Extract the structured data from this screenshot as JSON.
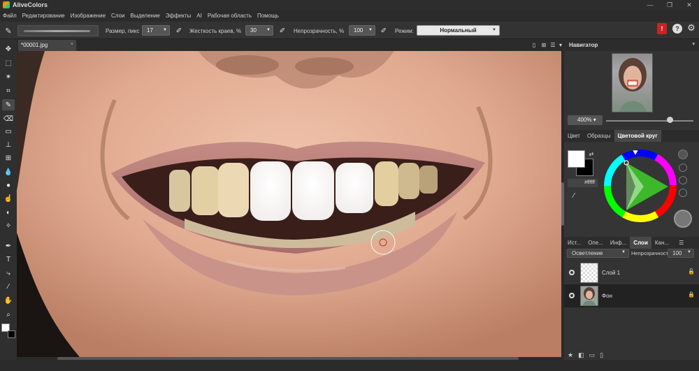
{
  "app": {
    "title": "AliveColors"
  },
  "window": {
    "minimize": "—",
    "maximize": "❐",
    "close": "✕"
  },
  "menu": [
    "Файл",
    "Редактирование",
    "Изображение",
    "Слои",
    "Выделение",
    "Эффекты",
    "AI",
    "Рабочая область",
    "Помощь"
  ],
  "options": {
    "size_label": "Размер, пикс",
    "size_value": "17",
    "hardness_label": "Жесткость краев, %",
    "hardness_value": "30",
    "opacity_label": "Непрозрачность, %",
    "opacity_value": "100",
    "mode_label": "Режим:",
    "mode_value": "Нормальный"
  },
  "document": {
    "tab_label": "*00001.jpg"
  },
  "navigator": {
    "title": "Навигатор",
    "zoom": "400%"
  },
  "color_tabs": [
    "Цвет",
    "Образцы",
    "Цветовой круг"
  ],
  "color": {
    "hex": "#ffffff",
    "foreground": "#ffffff",
    "background": "#000000"
  },
  "layer_tabs": [
    "Ист...",
    "Опе...",
    "Инф...",
    "Слои",
    "Кан..."
  ],
  "layers": {
    "blend_mode": "Осветление",
    "opacity_label": "Непрозрачность",
    "opacity_value": "100",
    "items": [
      {
        "name": "Слой 1"
      },
      {
        "name": "Фон"
      }
    ]
  }
}
